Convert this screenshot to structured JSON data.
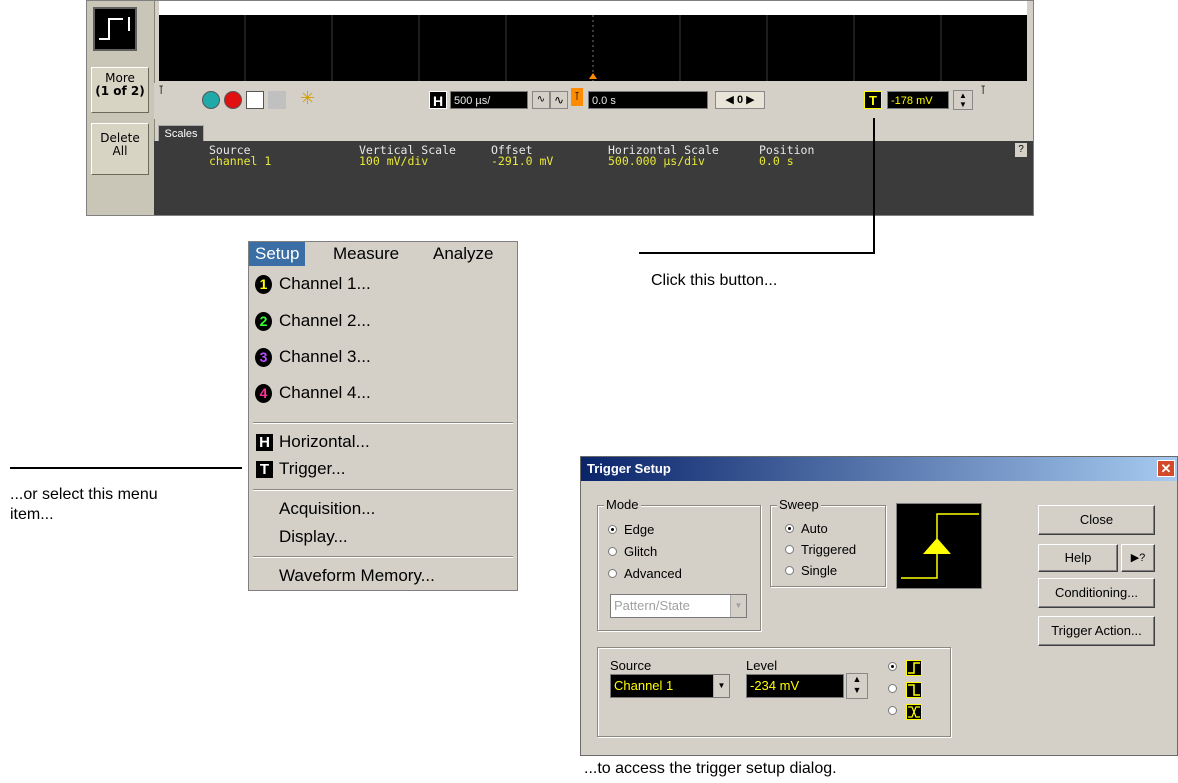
{
  "scope": {
    "more_line1": "More",
    "more_line2": "(1 of 2)",
    "delete_line1": "Delete",
    "delete_line2": "All",
    "h_label": "H",
    "timebase": "500 µs/",
    "delay": "0.0 s",
    "nav_value": "0",
    "t_label": "T",
    "trigger_level": "-178 mV",
    "scales_tab": "Scales",
    "help_glyph": "?",
    "headers": [
      "Source",
      "Vertical Scale",
      "Offset",
      "Horizontal Scale",
      "Position"
    ],
    "values": [
      "channel 1",
      "100 mV/div",
      "-291.0 mV",
      "500.000 µs/div",
      "0.0 s"
    ]
  },
  "menu": {
    "bar": [
      "Setup",
      "Measure",
      "Analyze"
    ],
    "items": [
      {
        "badge": "1",
        "label": "Channel 1...",
        "color": "#ffff00"
      },
      {
        "badge": "2",
        "label": "Channel 2...",
        "color": "#33ff33"
      },
      {
        "badge": "3",
        "label": "Channel 3...",
        "color": "#b84dff"
      },
      {
        "badge": "4",
        "label": "Channel 4...",
        "color": "#ff3399"
      }
    ],
    "horizontal_badge": "H",
    "horizontal": "Horizontal...",
    "trigger_badge": "T",
    "trigger": "Trigger...",
    "acquisition": "Acquisition...",
    "display": "Display...",
    "waveform_memory": "Waveform Memory..."
  },
  "annotations": {
    "click_button": "Click this button...",
    "select_menu_1": "...or select this menu",
    "select_menu_2": "item...",
    "access_dialog": "...to access the trigger setup dialog."
  },
  "dialog": {
    "title": "Trigger Setup",
    "close_x": "✕",
    "mode_label": "Mode",
    "mode_options": [
      "Edge",
      "Glitch",
      "Advanced"
    ],
    "mode_selected": "Edge",
    "pattern_value": "Pattern/State",
    "sweep_label": "Sweep",
    "sweep_options": [
      "Auto",
      "Triggered",
      "Single"
    ],
    "sweep_selected": "Auto",
    "close_button": "Close",
    "help_button": "Help",
    "whats_this": "▶?",
    "conditioning_button": "Conditioning...",
    "trigger_action_button": "Trigger Action...",
    "source_label": "Source",
    "source_value": "Channel 1",
    "level_label": "Level",
    "level_value": "-234 mV"
  },
  "colors": {
    "accent_yellow": "#ffff00",
    "menu_highlight": "#3a6ea5",
    "panel_gray": "#d4d0c8"
  }
}
